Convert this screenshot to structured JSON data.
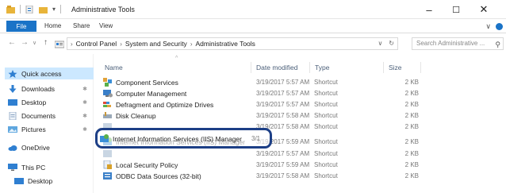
{
  "window": {
    "title": "Administrative Tools",
    "controls": {
      "minimize": "–",
      "maximize": "☐",
      "close": "✕"
    }
  },
  "ribbon": {
    "tabs": [
      "File",
      "Home",
      "Share",
      "View"
    ],
    "expand_glyph": "∨"
  },
  "address": {
    "back": "←",
    "forward": "→",
    "up": "↑",
    "breadcrumb": [
      "Control Panel",
      "System and Security",
      "Administrative Tools"
    ],
    "separator": "›",
    "dropdown": "∨",
    "refresh": "↻"
  },
  "search": {
    "placeholder": "Search Administrative ...",
    "glyph": "⚲"
  },
  "sidebar": {
    "items": [
      {
        "label": "Quick access",
        "icon": "star-icon",
        "selected": true,
        "pinned": false
      },
      {
        "label": "Downloads",
        "icon": "download-arrow-icon",
        "selected": false,
        "pinned": true
      },
      {
        "label": "Desktop",
        "icon": "desktop-folder-icon",
        "selected": false,
        "pinned": true
      },
      {
        "label": "Documents",
        "icon": "documents-icon",
        "selected": false,
        "pinned": true
      },
      {
        "label": "Pictures",
        "icon": "pictures-icon",
        "selected": false,
        "pinned": true
      },
      {
        "label": "OneDrive",
        "icon": "cloud-icon",
        "selected": false,
        "pinned": false
      },
      {
        "label": "This PC",
        "icon": "computer-icon",
        "selected": false,
        "pinned": false
      },
      {
        "label": "Desktop",
        "icon": "desktop-folder-icon",
        "selected": false,
        "pinned": false
      }
    ],
    "pin_glyph": "✱"
  },
  "columns": {
    "name": "Name",
    "date": "Date modified",
    "type": "Type",
    "size": "Size"
  },
  "files": [
    {
      "name": "Component Services",
      "date": "3/19/2017 5:57 AM",
      "type": "Shortcut",
      "size": "2 KB",
      "icon": "component-services-icon"
    },
    {
      "name": "Computer Management",
      "date": "3/19/2017 5:57 AM",
      "type": "Shortcut",
      "size": "2 KB",
      "icon": "computer-management-icon"
    },
    {
      "name": "Defragment and Optimize Drives",
      "date": "3/19/2017 5:57 AM",
      "type": "Shortcut",
      "size": "2 KB",
      "icon": "defrag-icon"
    },
    {
      "name": "Disk Cleanup",
      "date": "3/19/2017 5:58 AM",
      "type": "Shortcut",
      "size": "2 KB",
      "icon": "disk-cleanup-icon"
    },
    {
      "name": "",
      "date": "3/19/2017 5:58 AM",
      "type": "Shortcut",
      "size": "2 KB",
      "icon": "shortcut-icon"
    },
    {
      "name": "Internet Information Services (IIS) Manager",
      "date": "3/19/2017 5:59 AM",
      "type": "Shortcut",
      "size": "2 KB",
      "icon": "iis-icon"
    },
    {
      "name": "",
      "date": "3/19/2017 5:57 AM",
      "type": "Shortcut",
      "size": "2 KB",
      "icon": "shortcut-icon"
    },
    {
      "name": "Local Security Policy",
      "date": "3/19/2017 5:59 AM",
      "type": "Shortcut",
      "size": "2 KB",
      "icon": "local-security-policy-icon"
    },
    {
      "name": "ODBC Data Sources (32-bit)",
      "date": "3/19/2017 5:58 AM",
      "type": "Shortcut",
      "size": "2 KB",
      "icon": "odbc-icon"
    }
  ],
  "colors": {
    "accent": "#1a73c7",
    "selection": "#cce8ff",
    "highlight_ring": "#1d3f86"
  }
}
